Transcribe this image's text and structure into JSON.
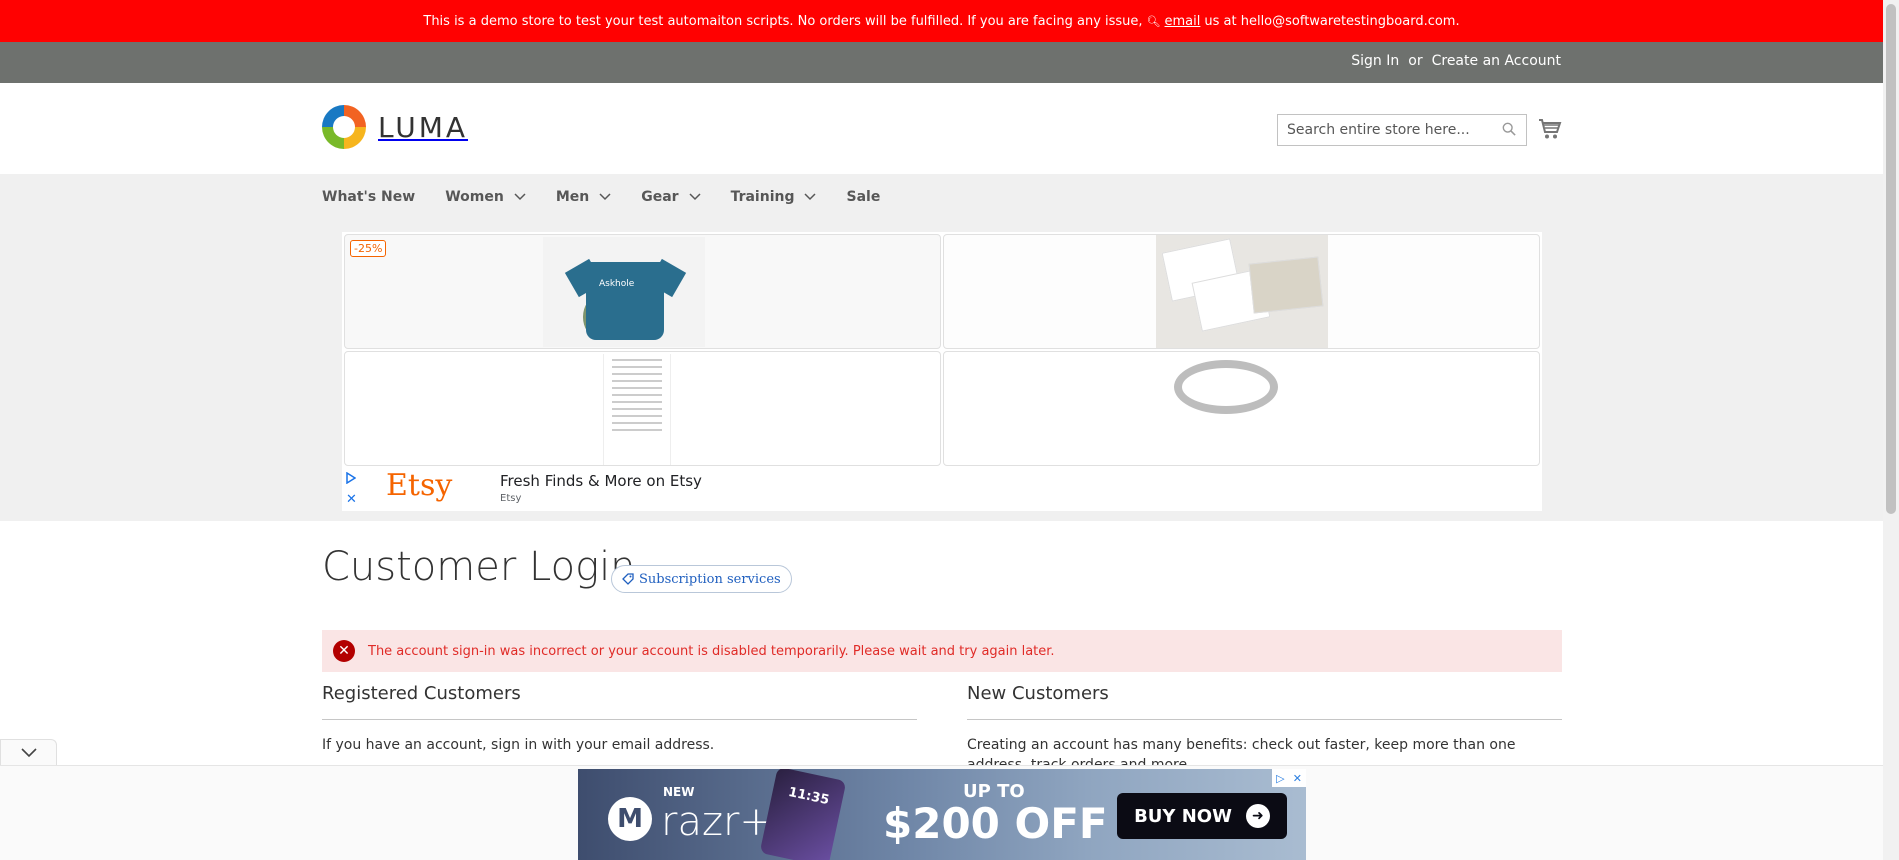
{
  "demo_notice": {
    "text_before": "This is a demo store to test your test automaiton scripts. No orders will be fulfilled. If you are facing any issue,",
    "email_link": "email",
    "text_after": "us at hello@softwaretestingboard.com."
  },
  "header_links": {
    "sign_in": "Sign In",
    "or": "or",
    "create_account": "Create an Account"
  },
  "logo": {
    "text": "LUMA"
  },
  "search": {
    "placeholder": "Search entire store here..."
  },
  "nav": {
    "items": [
      {
        "label": "What's New",
        "has_dropdown": false
      },
      {
        "label": "Women",
        "has_dropdown": true
      },
      {
        "label": "Men",
        "has_dropdown": true
      },
      {
        "label": "Gear",
        "has_dropdown": true
      },
      {
        "label": "Training",
        "has_dropdown": true
      },
      {
        "label": "Sale",
        "has_dropdown": false
      }
    ]
  },
  "ad": {
    "discount_badge": "-25%",
    "tshirt_text": "Askhole",
    "etsy_logo": "Etsy",
    "etsy_title": "Fresh Finds & More on Etsy",
    "etsy_sub": "Etsy"
  },
  "main": {
    "title": "Customer Login",
    "subscription_badge": "Subscription services",
    "error": "The account sign-in was incorrect or your account is disabled temporarily. Please wait and try again later.",
    "registered": {
      "title": "Registered Customers",
      "text": "If you have an account, sign in with your email address."
    },
    "new_customers": {
      "title": "New Customers",
      "text": "Creating an account has many benefits: check out faster, keep more than one address, track orders and more."
    }
  },
  "bottom_ad": {
    "new_label": "NEW",
    "product": "razr+",
    "time": "11:35",
    "up_to": "UP TO",
    "offer": "$200 OFF",
    "button": "BUY NOW"
  },
  "colors": {
    "demo_bar": "#ff0101",
    "panel_header": "#6e716e",
    "nav_bg": "#f0f0f0",
    "error_bg": "#fae5e5",
    "error_text": "#e02b27"
  }
}
